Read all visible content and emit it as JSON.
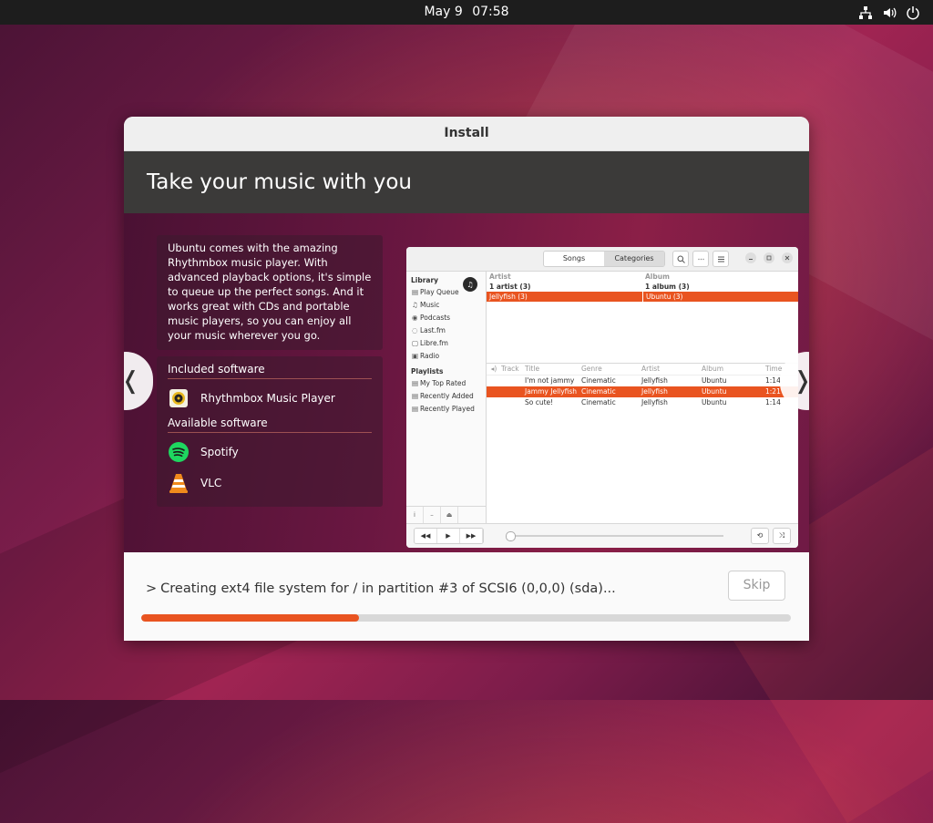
{
  "topbar": {
    "date": "May 9",
    "time": "07:58",
    "icons": [
      "network-icon",
      "volume-icon",
      "power-icon"
    ]
  },
  "window": {
    "title": "Install"
  },
  "slide": {
    "heading": "Take your music with you",
    "description": "Ubuntu comes with the amazing Rhythmbox music player. With advanced playback options, it's simple to queue up the perfect songs. And it works great with CDs and portable music players, so you can enjoy all your music wherever you go.",
    "included_heading": "Included software",
    "included": [
      {
        "name": "Rhythmbox Music Player",
        "icon": "rhythmbox-icon"
      }
    ],
    "available_heading": "Available software",
    "available": [
      {
        "name": "Spotify",
        "icon": "spotify-icon"
      },
      {
        "name": "VLC",
        "icon": "vlc-icon"
      }
    ],
    "prev_glyph": "❬",
    "next_glyph": "❭"
  },
  "rhythmbox": {
    "tabs": [
      "Songs",
      "Categories"
    ],
    "library_title": "Library",
    "library": [
      "Play Queue",
      "Music",
      "Podcasts",
      "Last.fm",
      "Libre.fm",
      "Radio"
    ],
    "playlists_title": "Playlists",
    "playlists": [
      "My Top Rated",
      "Recently Added",
      "Recently Played"
    ],
    "browser_headers": [
      "Artist",
      "Album"
    ],
    "browser_summary": [
      "1 artist (3)",
      "1 album (3)"
    ],
    "browser_selected": [
      "Jellyfish (3)",
      "Ubuntu (3)"
    ],
    "track_headers": [
      "Track",
      "Title",
      "Genre",
      "Artist",
      "Album",
      "Time"
    ],
    "tracks": [
      {
        "track": "",
        "title": "I'm not jammy",
        "genre": "Cinematic",
        "artist": "Jellyfish",
        "album": "Ubuntu",
        "time": "1:14"
      },
      {
        "track": "",
        "title": "Jammy Jellyfish",
        "genre": "Cinematic",
        "artist": "Jellyfish",
        "album": "Ubuntu",
        "time": "1:21"
      },
      {
        "track": "",
        "title": "So cute!",
        "genre": "Cinematic",
        "artist": "Jellyfish",
        "album": "Ubuntu",
        "time": "1:14"
      }
    ],
    "selected_track_index": 1,
    "seek_fraction": 0.0
  },
  "status": {
    "chevron": ">",
    "message": "Creating ext4 file system for / in partition #3 of SCSI6 (0,0,0) (sda)...",
    "skip_label": "Skip",
    "progress_percent": 33.5
  },
  "colors": {
    "accent": "#e95420",
    "topbar": "#1d1d1d",
    "header": "#3b3a39"
  }
}
